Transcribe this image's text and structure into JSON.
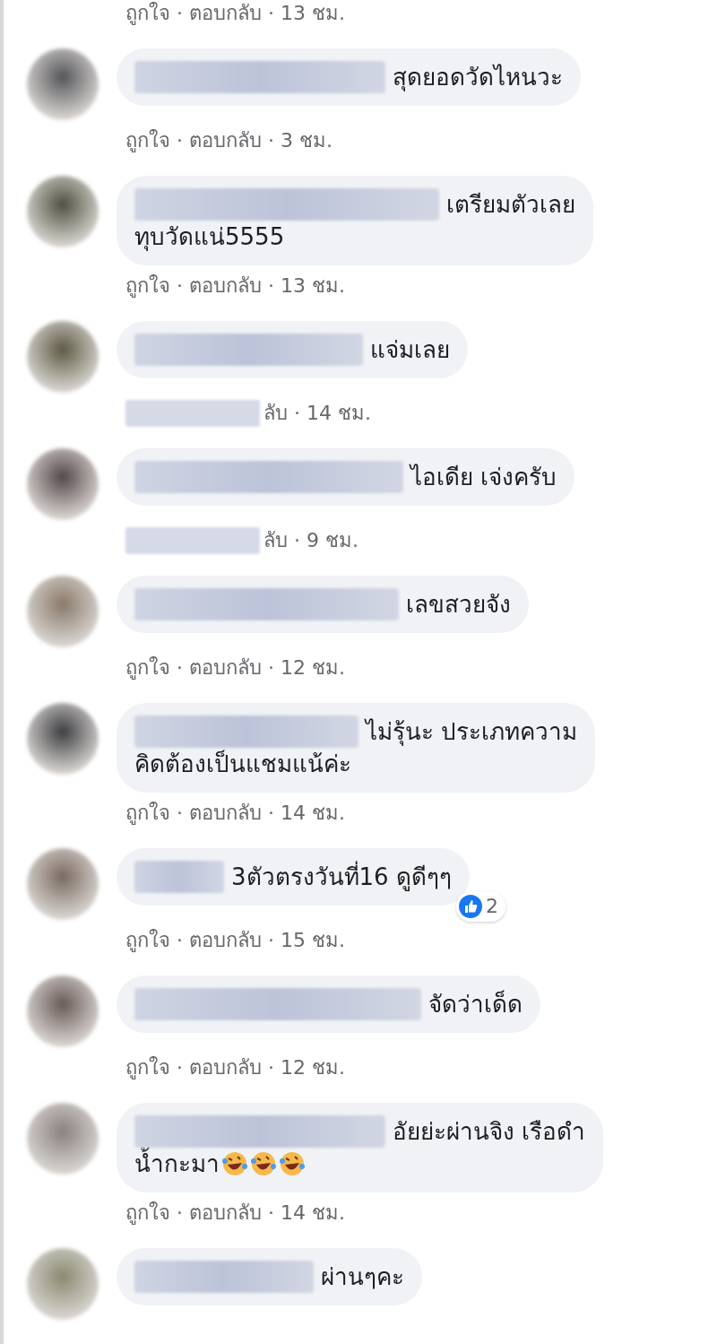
{
  "top_meta": "ถูกใจ · ตอบกลับ · 13 ชม.",
  "comments": [
    {
      "lines": [
        "สุดยอดวัดไหนวะ"
      ],
      "meta": "ถูกใจ · ตอบกลับ · 3 ชม."
    },
    {
      "lines": [
        "เตรียมตัวเลย",
        "ทุบวัดแน่5555"
      ],
      "meta": "ถูกใจ · ตอบกลับ · 13 ชม."
    },
    {
      "lines": [
        "แจ่มเลย"
      ],
      "meta": "ลับ · 14 ชม.",
      "meta_redacted": true
    },
    {
      "lines": [
        "ไอเดีย เจ่งครับ"
      ],
      "meta": "ลับ · 9 ชม.",
      "meta_redacted": true
    },
    {
      "lines": [
        "เลขสวยจัง"
      ],
      "meta": "ถูกใจ · ตอบกลับ · 12 ชม."
    },
    {
      "lines": [
        "ไม่รุ้นะ ประเภทความ",
        "คิดต้องเป็นแชมแน้ค่ะ"
      ],
      "meta": "ถูกใจ · ตอบกลับ · 14 ชม."
    },
    {
      "lines": [
        "3ตัวตรงวันที่16 ดูดีๆๆ"
      ],
      "meta": "ถูกใจ · ตอบกลับ · 15 ชม.",
      "reactions": {
        "count": "2"
      }
    },
    {
      "lines": [
        "จัดว่าเด็ด"
      ],
      "meta": "ถูกใจ · ตอบกลับ · 12 ชม."
    },
    {
      "lines": [
        "อัยย่ะผ่านจิง เรือดำ",
        "น้ำกะมา"
      ],
      "emoji": [
        {
          "kind": "rofl"
        },
        {
          "kind": "rofl"
        },
        {
          "kind": "rofl"
        }
      ],
      "meta": "ถูกใจ · ตอบกลับ · 14 ชม."
    },
    {
      "lines": [
        "ผ่านๆคะ"
      ]
    }
  ]
}
